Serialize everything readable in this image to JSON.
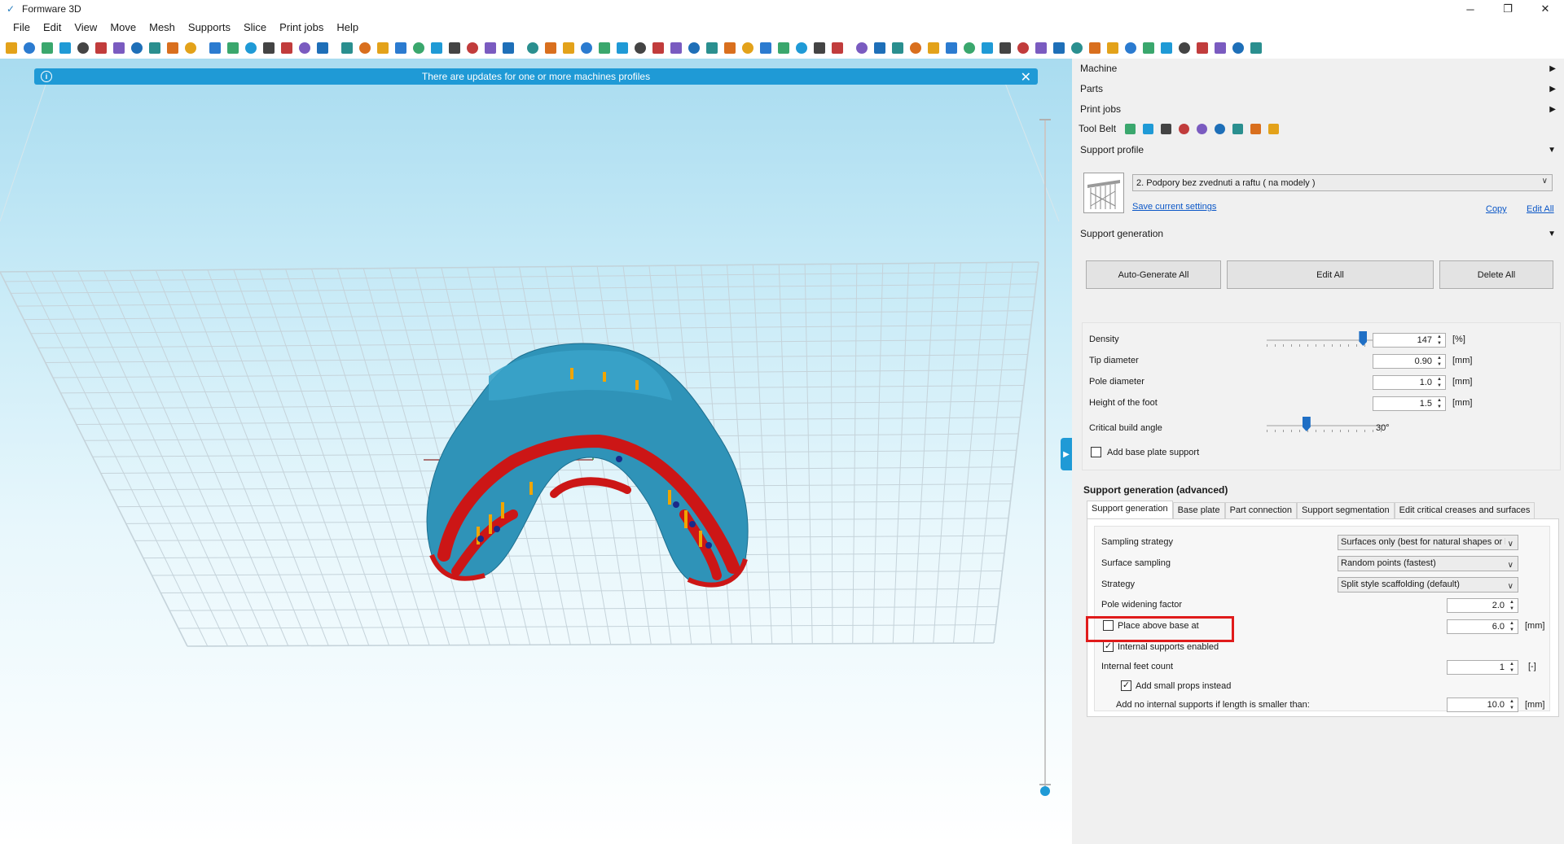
{
  "window": {
    "title": "Formware 3D",
    "controls": {
      "minimize": "─",
      "restore": "❐",
      "close": "✕"
    }
  },
  "menu": [
    "File",
    "Edit",
    "View",
    "Move",
    "Mesh",
    "Supports",
    "Slice",
    "Print jobs",
    "Help"
  ],
  "toolbar": {
    "icons": [
      "new-file-icon",
      "open-icon",
      "import-icon",
      "open-folder-icon",
      "copy-icon",
      "save-icon",
      "save-all-icon",
      "printer-icon",
      "gear-icon",
      "export-icon",
      "export-alt-icon",
      "undo-icon",
      "redo-icon",
      "sphere-icon",
      "delete-icon",
      "info-icon",
      "zoom-icon",
      "pen-icon",
      "view-iso-icon",
      "view-front-icon",
      "view-right-icon",
      "view-top-icon",
      "view-left-icon",
      "view-back-icon",
      "view-bottom-icon",
      "view-perspective-icon",
      "grid-icon",
      "globe-icon",
      "move-icon",
      "scale-icon",
      "rotate-icon",
      "mirror-icon",
      "lattice-icon",
      "slice-icon",
      "plane-icon",
      "section-icon",
      "paint-icon",
      "mesh-repair-icon",
      "support-icon",
      "support-tree-icon",
      "support-branch-icon",
      "raft-icon",
      "cut-icon",
      "measure-icon",
      "arrange-icon",
      "orient-icon",
      "hollow-icon",
      "drain-icon",
      "pattern-icon",
      "label-icon",
      "point-icon",
      "ring-icon",
      "cylinder-icon",
      "cone-icon",
      "torus-icon",
      "circle-icon",
      "shell-icon",
      "smooth-icon",
      "texture-icon",
      "layer-icon",
      "analysis-icon",
      "stats-icon",
      "stack-icon",
      "flag-icon",
      "arrow-icon",
      "screen-icon",
      "window-icon",
      "external-icon",
      "stl-icon"
    ]
  },
  "banner": {
    "text": "There are updates for one or more machines profiles",
    "info_icon": "i",
    "close_icon": "✕"
  },
  "panel_toggle": "▶",
  "panel": {
    "sections": {
      "machine": "Machine",
      "parts": "Parts",
      "print_jobs": "Print jobs",
      "support_profile": "Support profile",
      "support_generation": "Support generation"
    },
    "arrows": {
      "collapsed": "▶",
      "expanded": "▼"
    },
    "tool_belt": {
      "label": "Tool Belt",
      "icons": [
        "support-tree-icon",
        "raft-icon",
        "lattice-icon",
        "ring-icon",
        "circle-icon",
        "measure-icon",
        "analysis-icon",
        "stats-icon",
        "stack-icon"
      ]
    },
    "profile": {
      "selected": "2. Podpory bez zvednuti a raftu ( na modely )",
      "save_link": "Save current settings",
      "copy_link": "Copy",
      "edit_all_link": "Edit All",
      "dropdown_arrow": "∨"
    },
    "buttons": {
      "auto_generate": "Auto-Generate All",
      "edit_all": "Edit All",
      "delete_all": "Delete All"
    },
    "basic": {
      "density": {
        "label": "Density",
        "value": "147",
        "unit": "[%]",
        "slider_fraction": 0.8
      },
      "tip_diameter": {
        "label": "Tip diameter",
        "value": "0.90",
        "unit": "[mm]"
      },
      "pole_diameter": {
        "label": "Pole diameter",
        "value": "1.0",
        "unit": "[mm]"
      },
      "foot_height": {
        "label": "Height of the foot",
        "value": "1.5",
        "unit": "[mm]"
      },
      "critical_angle": {
        "label": "Critical build angle",
        "value": "30°",
        "slider_fraction": 0.33
      },
      "base_plate_support": {
        "label": "Add base plate support",
        "checked": false
      }
    },
    "advanced": {
      "title": "Support generation (advanced)",
      "tabs": [
        "Support generation",
        "Base plate",
        "Part connection",
        "Support segmentation",
        "Edit critical creases and surfaces"
      ],
      "sampling_strategy": {
        "label": "Sampling strategy",
        "value": "Surfaces only (best for natural shapes or hi"
      },
      "surface_sampling": {
        "label": "Surface sampling",
        "value": "Random points (fastest)"
      },
      "strategy": {
        "label": "Strategy",
        "value": "Split style scaffolding (default)"
      },
      "pole_widening": {
        "label": "Pole widening factor",
        "value": "2.0"
      },
      "place_above_base": {
        "label": "Place above base at",
        "value": "6.0",
        "unit": "[mm]",
        "checked": false
      },
      "internal_supports": {
        "label": "Internal supports enabled",
        "checked": true
      },
      "internal_feet": {
        "label": "Internal feet count",
        "value": "1",
        "unit": "[-]"
      },
      "small_props": {
        "label": "Add small props instead",
        "checked": true
      },
      "no_internal": {
        "label": "Add no internal supports if length is smaller than:",
        "value": "10.0",
        "unit": "[mm]"
      }
    }
  },
  "colors": {
    "accent": "#1f9ad6",
    "model": "#2f93b8",
    "supports": "#cc1616",
    "highlight": "#e01b1b"
  }
}
